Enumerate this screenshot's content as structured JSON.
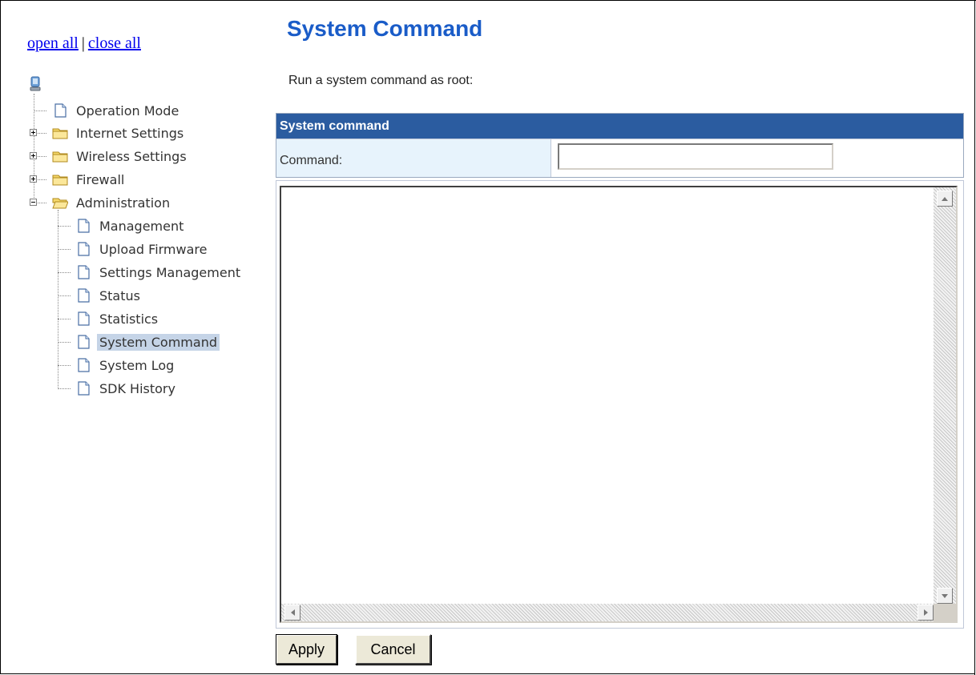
{
  "sidebar": {
    "open_all": "open all",
    "separator": "|",
    "close_all": "close all",
    "items": [
      {
        "label": "Operation Mode"
      },
      {
        "label": "Internet Settings"
      },
      {
        "label": "Wireless Settings"
      },
      {
        "label": "Firewall"
      },
      {
        "label": "Administration"
      },
      {
        "label": "Management"
      },
      {
        "label": "Upload Firmware"
      },
      {
        "label": "Settings Management"
      },
      {
        "label": "Status"
      },
      {
        "label": "Statistics"
      },
      {
        "label": "System Command"
      },
      {
        "label": "System Log"
      },
      {
        "label": "SDK History"
      }
    ],
    "selected": "System Command"
  },
  "main": {
    "title": "System Command",
    "intro": "Run a system command as root:",
    "section_header": "System command",
    "command_label": "Command:",
    "command_value": "",
    "output_text": ""
  },
  "buttons": {
    "apply": "Apply",
    "cancel": "Cancel"
  },
  "colors": {
    "title": "#1a5cc8",
    "header_bg": "#2b5ca0",
    "label_bg": "#e7f3fc",
    "selected_bg": "#c5d4e7",
    "link": "#0000ee"
  }
}
